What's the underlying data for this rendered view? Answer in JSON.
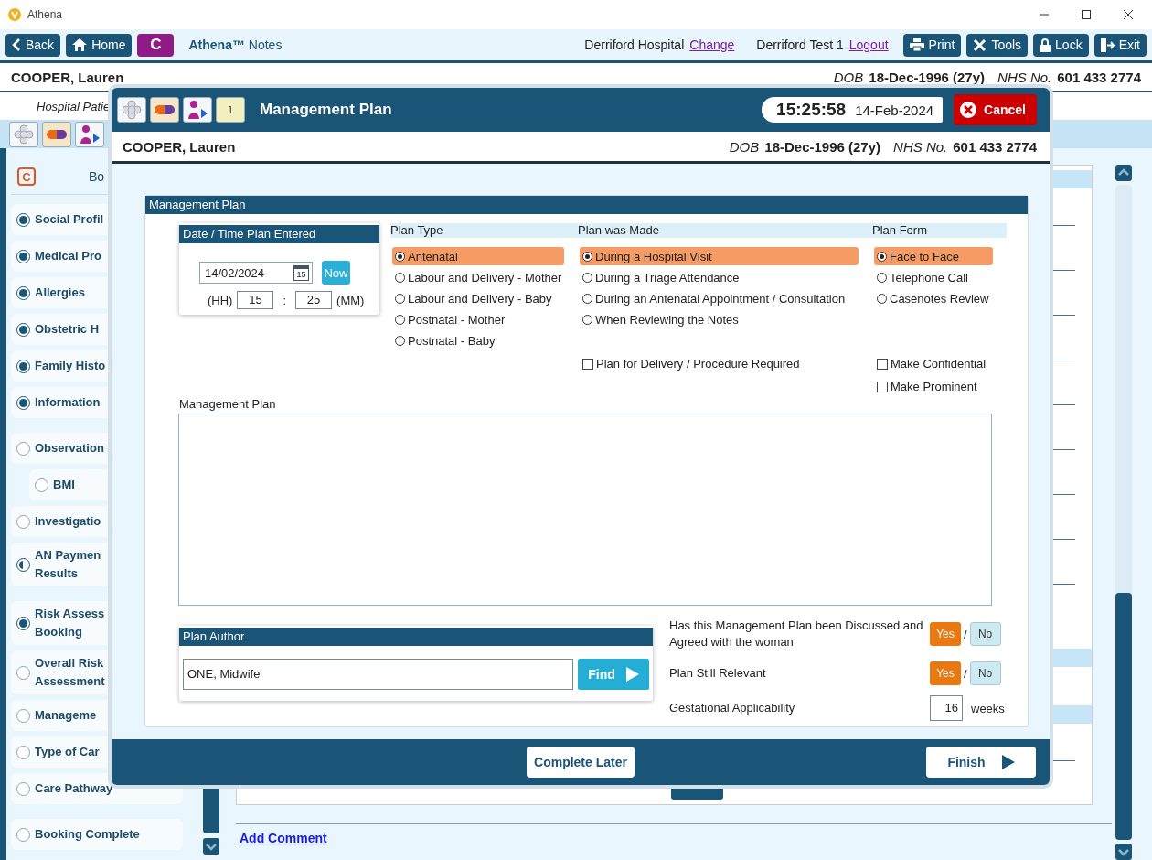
{
  "window": {
    "title": "Athena"
  },
  "toolbar": {
    "left_buttons": [
      {
        "label": "Back"
      },
      {
        "label": "Home"
      },
      {
        "label": "C"
      }
    ],
    "app_name": "**Athena™** Notes",
    "site": "Derriford Hospital",
    "site_link": "Change",
    "user": "Derriford Test 1",
    "user_link": "Logout",
    "right_buttons": [
      {
        "label": "Print"
      },
      {
        "label": "Tools"
      },
      {
        "label": "Lock"
      },
      {
        "label": "Exit"
      }
    ]
  },
  "patient": {
    "name": "COOPER, Lauren",
    "dob_label": "DOB",
    "dob": "18-Dec-1996 (27y)",
    "nhs_label": "NHS No.",
    "nhs": "601 433 2774"
  },
  "sub_banner": "Hospital Patie",
  "sidebar": {
    "header_icon": "C",
    "header": "Bo",
    "groups": [
      {
        "items": [
          {
            "kind": "radio",
            "lines": [
              "Social Profil"
            ],
            "checked": true
          },
          {
            "kind": "radio",
            "lines": [
              "Medical Pro"
            ],
            "checked": true
          },
          {
            "kind": "radio",
            "lines": [
              "Allergies"
            ],
            "checked": true
          },
          {
            "kind": "radio",
            "lines": [
              "Obstetric H"
            ],
            "checked": true
          },
          {
            "kind": "radio",
            "lines": [
              "Family Histo"
            ],
            "checked": true
          },
          {
            "kind": "radio",
            "lines": [
              "Information"
            ],
            "checked": true
          }
        ]
      },
      {
        "items": [
          {
            "kind": "radio",
            "lines": [
              "Observation"
            ],
            "checked": false,
            "children": [
              {
                "kind": "radio",
                "lines": [
                  "BMI"
                ],
                "checked": false
              }
            ]
          },
          {
            "kind": "radio",
            "lines": [
              "Investigatio"
            ],
            "checked": false
          },
          {
            "kind": "partial",
            "lines": [
              "AN Paymen",
              "Results"
            ]
          }
        ]
      },
      {
        "items": [
          {
            "kind": "radio",
            "lines": [
              "Risk Assess",
              "Booking"
            ],
            "checked": true
          },
          {
            "kind": "radio",
            "lines": [
              "Overall Risk",
              "Assessment"
            ],
            "checked": false
          },
          {
            "kind": "radio",
            "lines": [
              "Manageme"
            ],
            "checked": false
          },
          {
            "kind": "radio",
            "lines": [
              "Type of Car"
            ],
            "checked": false
          },
          {
            "kind": "radio",
            "lines": [
              "Care Pathway"
            ],
            "checked": false
          }
        ]
      },
      {
        "items": [
          {
            "kind": "radio",
            "lines": [
              "Booking Complete"
            ],
            "checked": false
          }
        ]
      }
    ]
  },
  "add_comment": "Add Comment",
  "modal": {
    "notes_badge": "1",
    "title": "Management Plan",
    "time": "15:25:58",
    "date": "14-Feb-2024",
    "cancel": "Cancel",
    "patient": {
      "name": "COOPER, Lauren",
      "dob_label": "DOB",
      "dob": "18-Dec-1996 (27y)",
      "nhs_label": "NHS No.",
      "nhs": "601 433 2774"
    },
    "card_title": "Management Plan",
    "date_box": {
      "title": "Date / Time Plan Entered",
      "date": "14/02/2024",
      "calendar_day": "15",
      "now": "Now",
      "hh_label": "(HH)",
      "hh": "15",
      "separator": ":",
      "mm": "25",
      "mm_label": "(MM)"
    },
    "columns": [
      {
        "heading": "Plan Type",
        "options": [
          {
            "label": "Antenatal",
            "selected": true
          },
          {
            "label": "Labour and Delivery - Mother",
            "selected": false
          },
          {
            "label": "Labour and Delivery - Baby",
            "selected": false
          },
          {
            "label": "Postnatal - Mother",
            "selected": false
          },
          {
            "label": "Postnatal - Baby",
            "selected": false
          }
        ]
      },
      {
        "heading": "Plan was Made",
        "options": [
          {
            "label": "During a Hospital Visit",
            "selected": true
          },
          {
            "label": "During a Triage Attendance",
            "selected": false
          },
          {
            "label": "During an Antenatal Appointment / Consultation",
            "selected": false
          },
          {
            "label": "When Reviewing the Notes",
            "selected": false
          }
        ],
        "checks": [
          {
            "label": "Plan for Delivery / Procedure Required",
            "checked": false
          }
        ]
      },
      {
        "heading": "Plan Form",
        "options": [
          {
            "label": "Face to Face",
            "selected": true
          },
          {
            "label": "Telephone Call",
            "selected": false
          },
          {
            "label": "Casenotes Review",
            "selected": false
          }
        ],
        "checks": [
          {
            "label": "Make Confidential",
            "checked": false
          },
          {
            "label": "Make Prominent",
            "checked": false
          }
        ]
      }
    ],
    "plan_label": "Management Plan",
    "author": {
      "title": "Plan Author",
      "value": "ONE, Midwife",
      "find": "Find"
    },
    "questions": [
      {
        "kind": "yesno",
        "label": "Has this Management Plan been Discussed and Agreed with the woman",
        "separator": "/",
        "options": [
          {
            "label": "Yes",
            "selected": true
          },
          {
            "label": "No",
            "selected": false
          }
        ]
      },
      {
        "kind": "yesno",
        "label": "Plan Still Relevant",
        "separator": "/",
        "options": [
          {
            "label": "Yes",
            "selected": true
          },
          {
            "label": "No",
            "selected": false
          }
        ]
      },
      {
        "kind": "number",
        "label": "Gestational Applicability",
        "value": "16",
        "unit": "weeks"
      }
    ],
    "complete_later": "Complete Later",
    "finish": "Finish"
  }
}
